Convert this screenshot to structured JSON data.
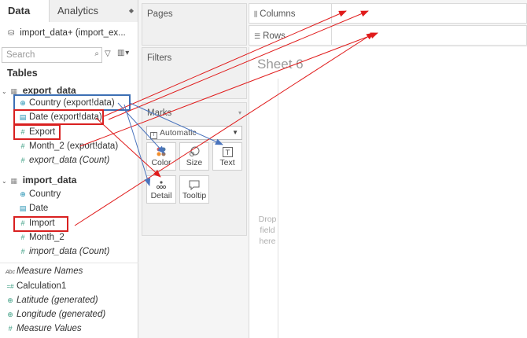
{
  "data_pane": {
    "tabs": [
      {
        "label": "Data"
      },
      {
        "label": "Analytics"
      }
    ],
    "datasource": "import_data+ (import_ex...",
    "search": {
      "placeholder": "Search",
      "value": ""
    },
    "tables_heading": "Tables",
    "groups": [
      {
        "name": "export_data",
        "fields": [
          {
            "label": "Country (export!data)",
            "icon": "globe-icon"
          },
          {
            "label": "Date (export!data)",
            "icon": "calendar-icon"
          },
          {
            "label": "Export",
            "icon": "measure-icon"
          },
          {
            "label": "Month_2 (export!data)",
            "icon": "measure-icon"
          },
          {
            "label": "export_data (Count)",
            "icon": "measure-icon"
          }
        ]
      },
      {
        "name": "import_data",
        "fields": [
          {
            "label": "Country",
            "icon": "globe-icon"
          },
          {
            "label": "Date",
            "icon": "calendar-icon"
          },
          {
            "label": "Import",
            "icon": "measure-icon"
          },
          {
            "label": "Month_2",
            "icon": "measure-icon"
          },
          {
            "label": "import_data (Count)",
            "icon": "measure-icon"
          }
        ]
      }
    ],
    "extra_fields": [
      {
        "label": "Measure Names",
        "icon": "abc-icon"
      },
      {
        "label": "Calculation1",
        "icon": "calculation-icon"
      },
      {
        "label": "Latitude (generated)",
        "icon": "globe-icon"
      },
      {
        "label": "Longitude (generated)",
        "icon": "globe-icon"
      },
      {
        "label": "Measure Values",
        "icon": "measure-icon"
      }
    ]
  },
  "pages": {
    "title": "Pages"
  },
  "filters": {
    "title": "Filters"
  },
  "marks": {
    "title": "Marks",
    "mark_type": "Automatic",
    "buttons": [
      {
        "label": "Color",
        "icon": "color-icon"
      },
      {
        "label": "Size",
        "icon": "size-icon"
      },
      {
        "label": "Text",
        "icon": "text-icon"
      },
      {
        "label": "Detail",
        "icon": "detail-icon"
      },
      {
        "label": "Tooltip",
        "icon": "tooltip-icon"
      }
    ]
  },
  "shelves": {
    "columns": "Columns",
    "rows": "Rows"
  },
  "sheet": {
    "title": "Sheet 6",
    "drop_hint": "Drop field here"
  },
  "annotations": {
    "highlight_red": "#d92020",
    "highlight_blue": "#3d6fb4",
    "arrow_red": "#e01b1b",
    "arrow_blue": "#4a74bd"
  }
}
